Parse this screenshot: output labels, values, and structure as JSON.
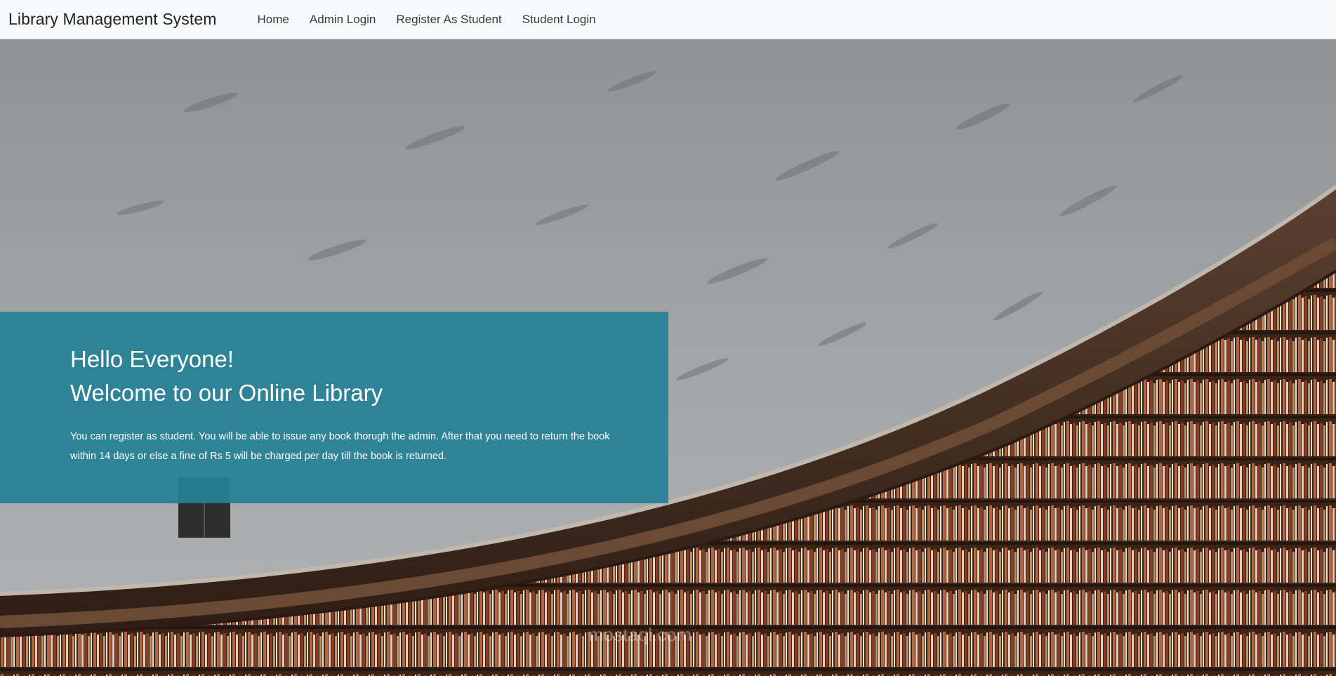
{
  "navbar": {
    "brand": "Library Management System",
    "links": [
      {
        "label": "Home"
      },
      {
        "label": "Admin Login"
      },
      {
        "label": "Register As Student"
      },
      {
        "label": "Student Login"
      }
    ]
  },
  "hero": {
    "greeting": "Hello Everyone!",
    "title": "Welcome to our Online Library",
    "description": "You can register as student. You will be able to issue any book thorugh the admin. After that you need to return the book within 14 days or else a fine of Rs 5 will be charged per day till the book is returned.",
    "box_color": "#268096",
    "watermark": "mostaql.com"
  }
}
